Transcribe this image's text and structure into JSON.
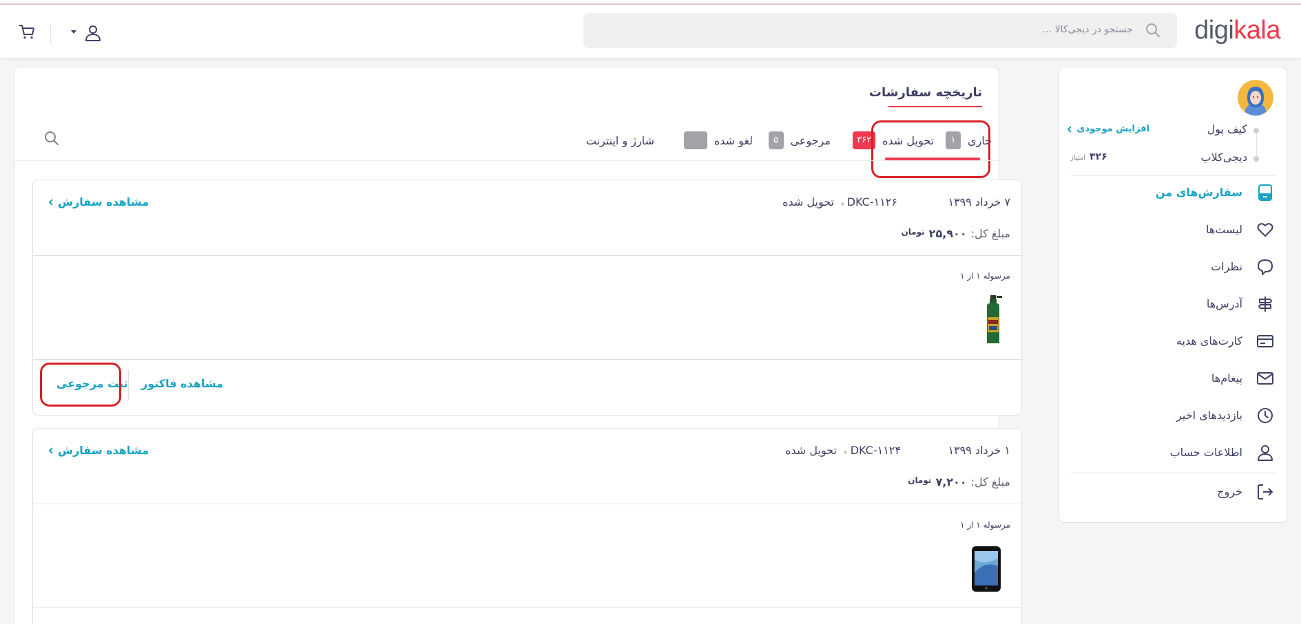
{
  "header": {
    "logo_part1": "digi",
    "logo_part2": "kala",
    "search_placeholder": "جستجو در دیجی‌کالا …",
    "icons": [
      "search-icon",
      "user-icon",
      "caret-down-icon",
      "cart-icon"
    ]
  },
  "page": {
    "title": "تاریخچه سفارشات",
    "tabs": [
      {
        "label": "جاری",
        "badge": "۱"
      },
      {
        "label": "تحویل شده",
        "badge": "۳۶۲",
        "active": true
      },
      {
        "label": "مرجوعی",
        "badge": "۵"
      },
      {
        "label": "لغو شده",
        "badge": ""
      },
      {
        "label": "شارژ و اینترنت"
      }
    ]
  },
  "orders": [
    {
      "date": "۷ خرداد ۱۳۹۹",
      "code": "DKC-۱۱۲۶",
      "status": "تحویل شده",
      "total_label": "مبلغ کل:",
      "total_value": "۲۵,۹۰۰",
      "currency": "تومان",
      "view_label": "مشاهده سفارش",
      "package_label": "مرسوله ۱ از ۱",
      "invoice_label": "مشاهده فاکتور",
      "return_label": "ثبت مرجوعی"
    },
    {
      "date": "۱ خرداد ۱۳۹۹",
      "code": "DKC-۱۱۲۴",
      "status": "تحویل شده",
      "total_label": "مبلغ کل:",
      "total_value": "۷,۲۰۰",
      "currency": "تومان",
      "view_label": "مشاهده سفارش",
      "package_label": "مرسوله ۱ از ۱"
    }
  ],
  "sidebar": {
    "wallet_label": "کیف پول",
    "wallet_link": "افزایش موجودی",
    "club_label": "دیجی‌کلاب",
    "club_score": "۳۲۶",
    "club_unit": "امتیاز",
    "items": [
      {
        "label": "سفارش‌های من",
        "icon": "orders-icon",
        "active": true
      },
      {
        "label": "لیست‌ها",
        "icon": "heart-icon"
      },
      {
        "label": "نظرات",
        "icon": "comment-icon"
      },
      {
        "label": "آدرس‌ها",
        "icon": "signpost-icon"
      },
      {
        "label": "کارت‌های هدیه",
        "icon": "gift-card-icon"
      },
      {
        "label": "پیغام‌ها",
        "icon": "envelope-icon"
      },
      {
        "label": "بازدیدهای اخیر",
        "icon": "clock-icon"
      },
      {
        "label": "اطلاعات حساب",
        "icon": "user-icon"
      },
      {
        "label": "خروج",
        "icon": "logout-icon"
      }
    ]
  },
  "colors": {
    "brand_red": "#ef394e",
    "link_teal": "#19a3c4",
    "text": "#3f4064",
    "highlight": "#d81f26"
  }
}
